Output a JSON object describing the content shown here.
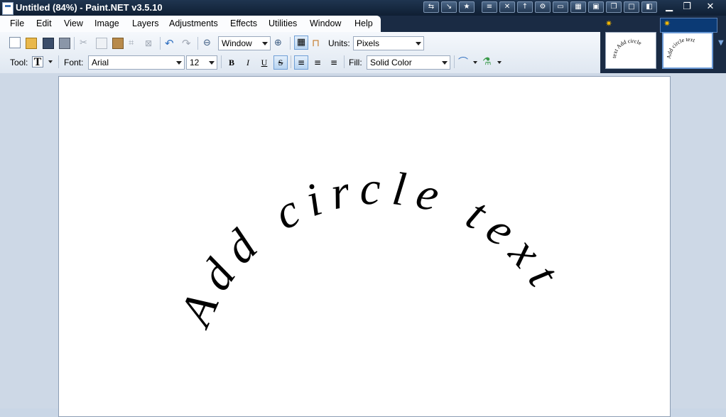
{
  "window": {
    "title": "Untitled (84%) - Paint.NET v3.5.10"
  },
  "menu": [
    "File",
    "Edit",
    "View",
    "Image",
    "Layers",
    "Adjustments",
    "Effects",
    "Utilities",
    "Window",
    "Help"
  ],
  "toolbar1": {
    "zoom_value": "Window",
    "units_label": "Units:",
    "units_value": "Pixels"
  },
  "toolbar2": {
    "tool_label": "Tool:",
    "font_label": "Font:",
    "font_value": "Arial",
    "size_value": "12",
    "bold": "B",
    "italic": "I",
    "underline": "U",
    "strike": "S",
    "fill_label": "Fill:",
    "fill_value": "Solid Color"
  },
  "thumbnails": [
    {
      "text": "text Add circle"
    },
    {
      "text": "Add circle text"
    }
  ],
  "canvas": {
    "curved_text": "Add circle text"
  },
  "colors": {
    "accent": "#3a6fb0",
    "titlebar": "#1a2b44",
    "workspace": "#cdd8e6"
  }
}
